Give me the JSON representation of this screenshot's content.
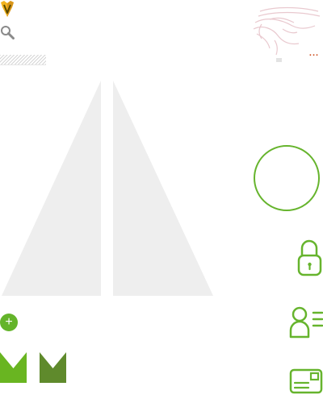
{
  "colors": {
    "accent_green": "#66b42d",
    "vote_light": "#69b521",
    "vote_dark": "#5f8a2c",
    "logo_gold": "#f1b320",
    "logo_dark": "#5a4a00",
    "menu_dots": "#cc4a1a",
    "placeholder_gray": "#eeeeee",
    "hatch_gray": "#d5d5d5"
  },
  "icons": {
    "logo": "fork-gift-logo-icon",
    "search": "search-icon",
    "brand": "horse-sketch-icon",
    "more": "more-dots-icon",
    "add": "plus-icon",
    "vote_light": "chevron-banner-icon",
    "vote_dark": "chevron-banner-icon",
    "circle": "ring-icon",
    "lock": "padlock-icon",
    "contacts": "contact-list-icon",
    "card": "id-card-icon"
  },
  "actions": {
    "add_label": "+",
    "more_label": "..."
  }
}
